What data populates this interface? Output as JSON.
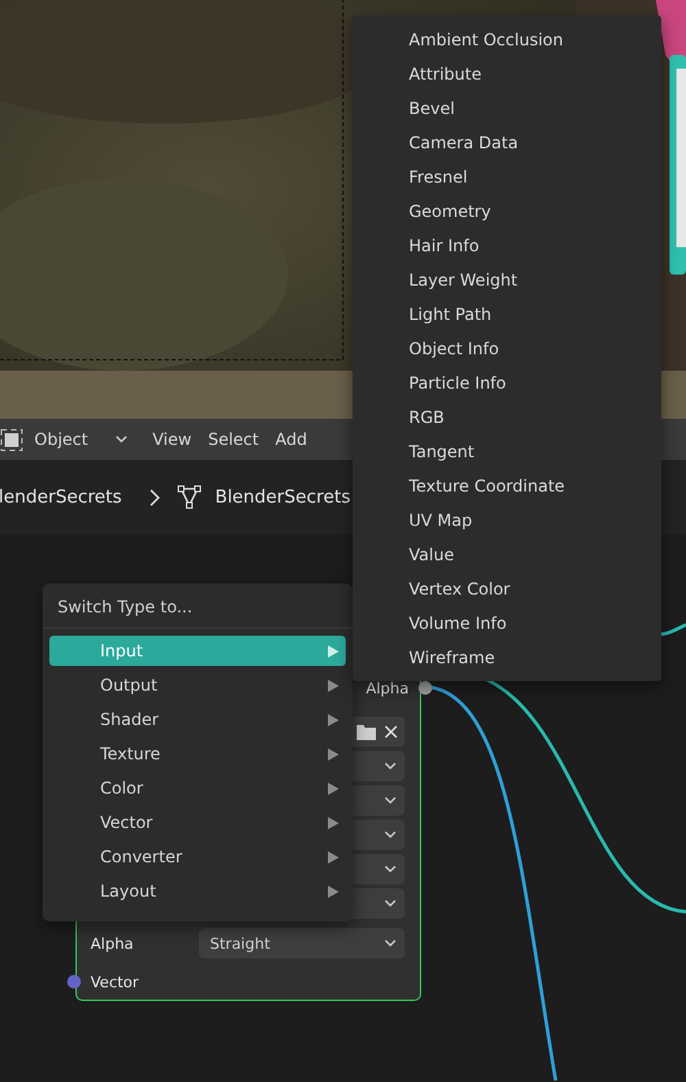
{
  "viewport_header": {
    "mode": "Object",
    "menus": [
      "View",
      "Select",
      "Add"
    ]
  },
  "breadcrumb": [
    "lenderSecrets",
    "BlenderSecrets"
  ],
  "node": {
    "outputs": [
      {
        "label": "Alpha"
      }
    ],
    "rows": [
      {
        "kind": "file"
      },
      {
        "kind": "dropdown"
      },
      {
        "kind": "dropdown"
      },
      {
        "kind": "dropdown"
      },
      {
        "kind": "dropdown"
      },
      {
        "kind": "dropdown"
      },
      {
        "kind": "dropdown",
        "label": "Alpha",
        "value": "Straight"
      }
    ],
    "inputs": [
      {
        "label": "Vector"
      }
    ]
  },
  "context_menu": {
    "title": "Switch Type to...",
    "items": [
      {
        "label": "Input",
        "selected": true
      },
      {
        "label": "Output",
        "selected": false
      },
      {
        "label": "Shader",
        "selected": false
      },
      {
        "label": "Texture",
        "selected": false
      },
      {
        "label": "Color",
        "selected": false
      },
      {
        "label": "Vector",
        "selected": false
      },
      {
        "label": "Converter",
        "selected": false
      },
      {
        "label": "Layout",
        "selected": false
      }
    ]
  },
  "submenu": {
    "items": [
      "Ambient Occlusion",
      "Attribute",
      "Bevel",
      "Camera Data",
      "Fresnel",
      "Geometry",
      "Hair Info",
      "Layer Weight",
      "Light Path",
      "Object Info",
      "Particle Info",
      "RGB",
      "Tangent",
      "Texture Coordinate",
      "UV Map",
      "Value",
      "Vertex Color",
      "Volume Info",
      "Wireframe"
    ]
  }
}
